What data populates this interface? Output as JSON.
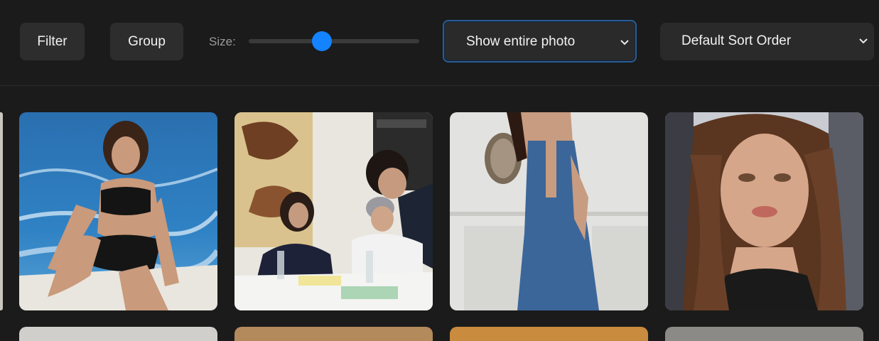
{
  "toolbar": {
    "filter_label": "Filter",
    "group_label": "Group",
    "size_label": "Size:",
    "size_level_fraction": 0.43,
    "view_select_value": "Show entire photo",
    "sort_select_value": "Default Sort Order",
    "accent_color": "#1383ff"
  },
  "photos": [
    {
      "subject": "woman in black bikini on a boat over blue sea"
    },
    {
      "subject": "group of people around a table with drinks"
    },
    {
      "subject": "woman in blue denim backless dress"
    },
    {
      "subject": "close-up portrait of a woman with long brown hair"
    }
  ],
  "icons": [
    "chevron-down-icon"
  ]
}
